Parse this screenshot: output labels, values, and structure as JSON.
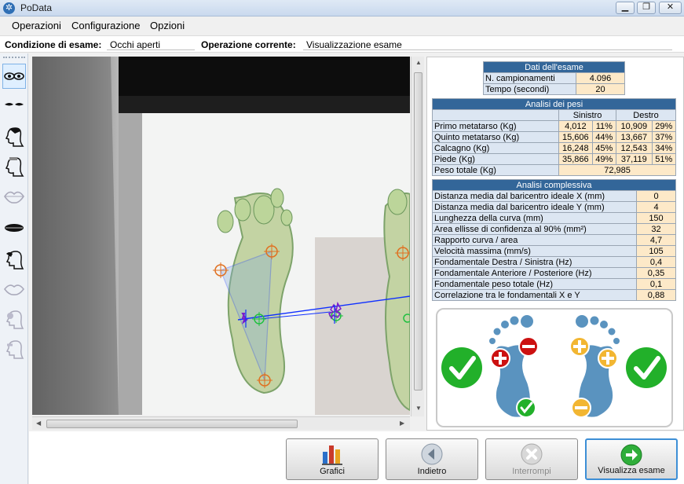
{
  "window": {
    "title": "PoData",
    "minimize": "▁",
    "maximize": "❐",
    "close": "✕"
  },
  "menu": [
    "Operazioni",
    "Configurazione",
    "Opzioni"
  ],
  "condition": {
    "label": "Condizione di esame:",
    "value": "Occhi aperti",
    "op_label": "Operazione corrente:",
    "op_value": "Visualizzazione esame"
  },
  "toolbar_icons": [
    "eyes-open-icon",
    "eyes-closed-icon",
    "head-profile-icon",
    "head-profile-alt-icon",
    "lips-icon",
    "closed-mouth-icon",
    "head-touch-icon",
    "lips-outline-icon",
    "head-disabled-icon",
    "head-disabled-alt-icon"
  ],
  "exam": {
    "title": "Dati dell'esame",
    "rows": [
      {
        "label": "N. campionamenti",
        "value": "4.096"
      },
      {
        "label": "Tempo (secondi)",
        "value": "20"
      }
    ]
  },
  "weights": {
    "title": "Analisi dei pesi",
    "left": "Sinistro",
    "right": "Destro",
    "rows": [
      {
        "label": "Primo metatarso (Kg)",
        "l": "4,012",
        "lp": "11%",
        "r": "10,909",
        "rp": "29%"
      },
      {
        "label": "Quinto metatarso (Kg)",
        "l": "15,606",
        "lp": "44%",
        "r": "13,667",
        "rp": "37%"
      },
      {
        "label": "Calcagno (Kg)",
        "l": "16,248",
        "lp": "45%",
        "r": "12,543",
        "rp": "34%"
      },
      {
        "label": "Piede (Kg)",
        "l": "35,866",
        "lp": "49%",
        "r": "37,119",
        "rp": "51%"
      }
    ],
    "total_label": "Peso totale (Kg)",
    "total": "72,985"
  },
  "overall": {
    "title": "Analisi complessiva",
    "rows": [
      {
        "label": "Distanza media dal baricentro ideale X (mm)",
        "value": "0"
      },
      {
        "label": "Distanza media dal baricentro ideale Y (mm)",
        "value": "4"
      },
      {
        "label": "Lunghezza della curva (mm)",
        "value": "150"
      },
      {
        "label": "Area ellisse di confidenza al 90% (mm²)",
        "value": "32"
      },
      {
        "label": "Rapporto curva / area",
        "value": "4,7"
      },
      {
        "label": "Velocità massima (mm/s)",
        "value": "105"
      },
      {
        "label": "Fondamentale Destra / Sinistra (Hz)",
        "value": "0,4"
      },
      {
        "label": "Fondamentale Anteriore / Posteriore (Hz)",
        "value": "0,35"
      },
      {
        "label": "Fondamentale peso totale (Hz)",
        "value": "0,1"
      },
      {
        "label": "Correlazione tra le fondamentali X e Y",
        "value": "0,88"
      }
    ]
  },
  "feet": {
    "left_status": "check",
    "right_status": "check",
    "left_markers": [
      "minus",
      "plus",
      "check"
    ],
    "right_markers": [
      "plus",
      "plus",
      "minus"
    ],
    "colors": {
      "green": "#22b02a",
      "red": "#cc1111",
      "amber": "#f2b632",
      "foot": "#5a93bf"
    }
  },
  "buttons": [
    {
      "label": "Grafici",
      "enabled": true
    },
    {
      "label": "Indietro",
      "enabled": true
    },
    {
      "label": "Interrompi",
      "enabled": false
    },
    {
      "label": "Visualizza esame",
      "enabled": true
    }
  ]
}
